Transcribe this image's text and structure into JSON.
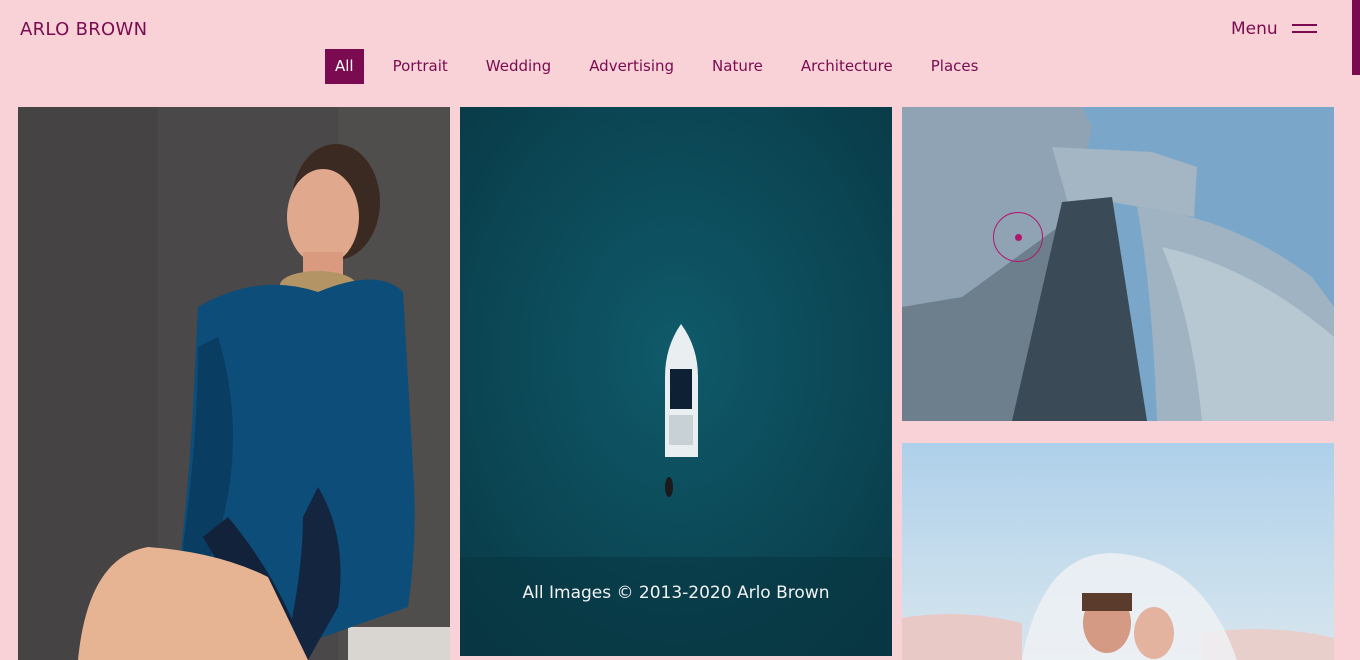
{
  "header": {
    "brand": "ARLO BROWN",
    "menu_label": "Menu",
    "menu_icon": "hamburger-icon"
  },
  "filters": [
    {
      "label": "All",
      "active": true
    },
    {
      "label": "Portrait",
      "active": false
    },
    {
      "label": "Wedding",
      "active": false
    },
    {
      "label": "Advertising",
      "active": false
    },
    {
      "label": "Nature",
      "active": false
    },
    {
      "label": "Architecture",
      "active": false
    },
    {
      "label": "Places",
      "active": false
    }
  ],
  "gallery": {
    "copyright": "All Images © 2013-2020 Arlo Brown"
  },
  "colors": {
    "background": "#f8d2d6",
    "accent": "#7a0b50"
  }
}
